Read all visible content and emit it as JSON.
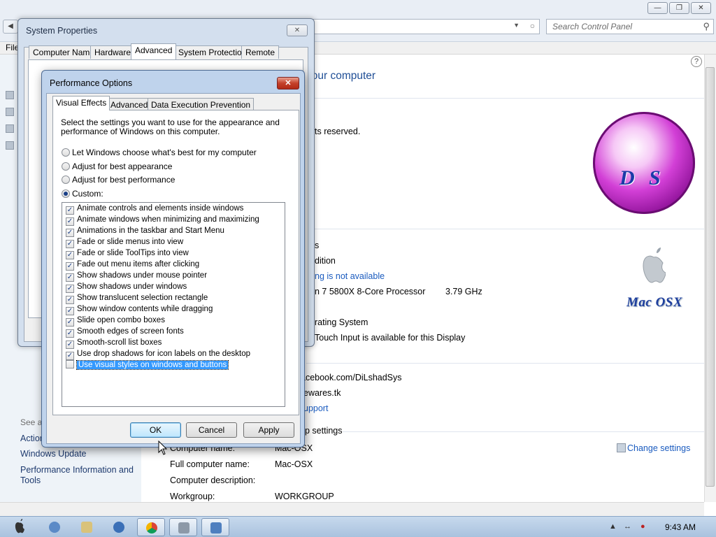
{
  "control_panel": {
    "search_placeholder": "Search Control Panel",
    "menu_file": "File",
    "main_title": "your computer",
    "copyright_fragment": "ts reserved.",
    "left_pane": {
      "see_also": "See al",
      "action": "Action",
      "windows_update": "Windows Update",
      "performance_line1": "Performance Information and",
      "performance_line2": "Tools"
    },
    "system": {
      "rating_fragment": "s",
      "edition_fragment": "dition",
      "rating_link_fragment": "ng is not available",
      "processor": "n 7 5800X 8-Core Processor",
      "processor_speed": "3.79 GHz",
      "system_type_fragment": "rating System",
      "pen_touch_fragment": "Touch Input is available for this Display"
    },
    "support": {
      "facebook_fragment": "acebook.com/DiLshadSys",
      "site_fragment": "ewares.tk",
      "support_link_fragment": "upport"
    },
    "computer_name_section": {
      "heading_fragment": "p settings",
      "change_settings": "Change settings",
      "rows": [
        {
          "label": "Computer name:",
          "value": "Mac-OSX"
        },
        {
          "label": "Full computer name:",
          "value": "Mac-OSX"
        },
        {
          "label": "Computer description:",
          "value": ""
        },
        {
          "label": "Workgroup:",
          "value": "WORKGROUP"
        }
      ]
    },
    "logo_ds_letters": [
      "D",
      "S"
    ],
    "logo_macosx_text": "Mac OSX"
  },
  "system_properties": {
    "title": "System Properties",
    "tabs": [
      "Computer Name",
      "Hardware",
      "Advanced",
      "System Protection",
      "Remote"
    ],
    "active_tab": "Advanced"
  },
  "performance_options": {
    "title": "Performance Options",
    "tabs": [
      "Visual Effects",
      "Advanced",
      "Data Execution Prevention"
    ],
    "active_tab": "Visual Effects",
    "description": "Select the settings you want to use for the appearance and performance of Windows on this computer.",
    "radio_options": [
      {
        "label": "Let Windows choose what's best for my computer",
        "selected": false
      },
      {
        "label": "Adjust for best appearance",
        "selected": false
      },
      {
        "label": "Adjust for best performance",
        "selected": false
      },
      {
        "label": "Custom:",
        "selected": true
      }
    ],
    "effects": [
      {
        "label": "Animate controls and elements inside windows",
        "checked": true
      },
      {
        "label": "Animate windows when minimizing and maximizing",
        "checked": true
      },
      {
        "label": "Animations in the taskbar and Start Menu",
        "checked": true
      },
      {
        "label": "Fade or slide menus into view",
        "checked": true
      },
      {
        "label": "Fade or slide ToolTips into view",
        "checked": true
      },
      {
        "label": "Fade out menu items after clicking",
        "checked": true
      },
      {
        "label": "Show shadows under mouse pointer",
        "checked": true
      },
      {
        "label": "Show shadows under windows",
        "checked": true
      },
      {
        "label": "Show translucent selection rectangle",
        "checked": true
      },
      {
        "label": "Show window contents while dragging",
        "checked": true
      },
      {
        "label": "Slide open combo boxes",
        "checked": true
      },
      {
        "label": "Smooth edges of screen fonts",
        "checked": true
      },
      {
        "label": "Smooth-scroll list boxes",
        "checked": true
      },
      {
        "label": "Use drop shadows for icon labels on the desktop",
        "checked": true
      },
      {
        "label": "Use visual styles on windows and buttons",
        "checked": false,
        "selected": true
      }
    ],
    "buttons": {
      "ok": "OK",
      "cancel": "Cancel",
      "apply": "Apply"
    }
  },
  "taskbar": {
    "clock": "9:43 AM",
    "icons": [
      "apple-start-icon",
      "ie-icon",
      "explorer-icon",
      "media-player-icon",
      "chrome-icon",
      "system-icon",
      "control-panel-icon"
    ]
  },
  "colors": {
    "link": "#1a5bbf",
    "title_blue": "#1f4e96",
    "selection": "#3399ff",
    "close_red": "#c4402a",
    "ds_magenta": "#d23fd6"
  }
}
